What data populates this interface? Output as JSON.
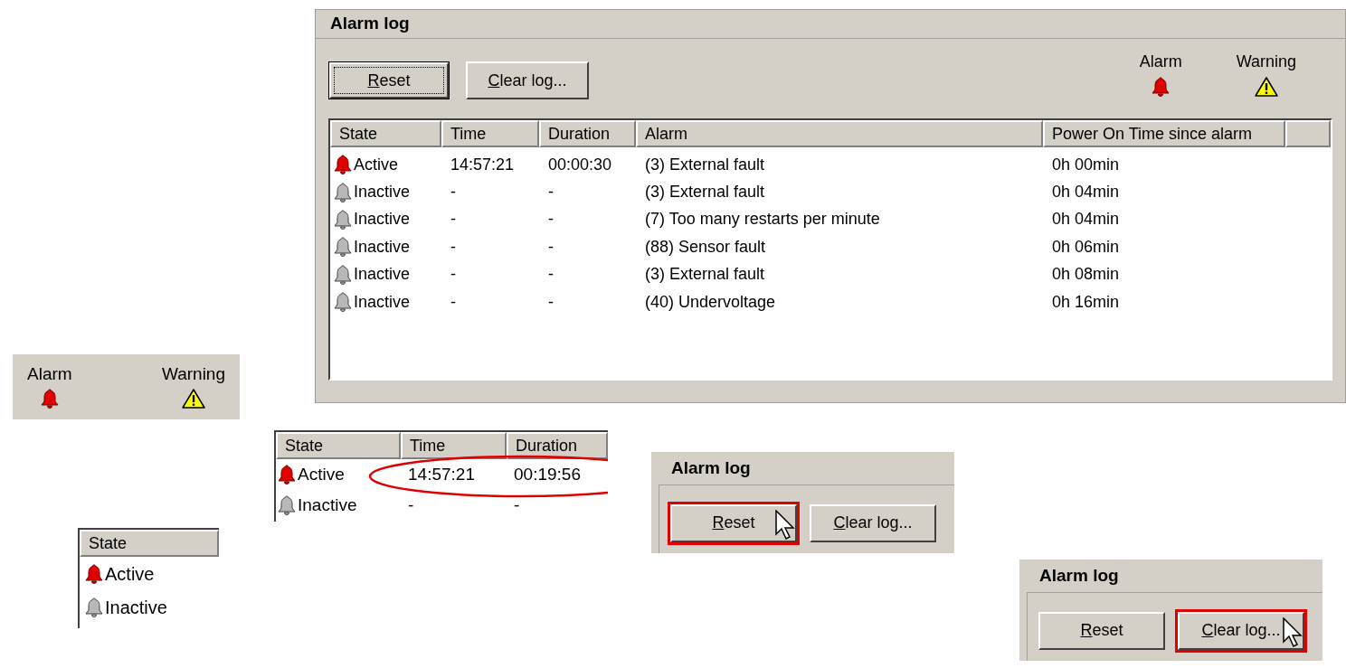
{
  "main_panel": {
    "title": "Alarm log",
    "buttons": [
      {
        "label": "Reset",
        "focused": true
      },
      {
        "label": "Clear log...",
        "focused": false
      }
    ],
    "legend": [
      {
        "label": "Alarm",
        "kind": "alarm"
      },
      {
        "label": "Warning",
        "kind": "warning"
      }
    ],
    "table": {
      "columns": [
        "State",
        "Time",
        "Duration",
        "Alarm",
        "Power On Time since alarm"
      ],
      "rows": [
        {
          "state": "Active",
          "active": true,
          "time": "14:57:21",
          "duration": "00:00:30",
          "alarm": "(3) External fault",
          "power_on_time": "0h 00min"
        },
        {
          "state": "Inactive",
          "active": false,
          "time": "-",
          "duration": "-",
          "alarm": "(3) External fault",
          "power_on_time": "0h 04min"
        },
        {
          "state": "Inactive",
          "active": false,
          "time": "-",
          "duration": "-",
          "alarm": "(7) Too many restarts per minute",
          "power_on_time": "0h 04min"
        },
        {
          "state": "Inactive",
          "active": false,
          "time": "-",
          "duration": "-",
          "alarm": "(88) Sensor fault",
          "power_on_time": "0h 06min"
        },
        {
          "state": "Inactive",
          "active": false,
          "time": "-",
          "duration": "-",
          "alarm": "(3) External fault",
          "power_on_time": "0h 08min"
        },
        {
          "state": "Inactive",
          "active": false,
          "time": "-",
          "duration": "-",
          "alarm": "(40) Undervoltage",
          "power_on_time": "0h 16min"
        }
      ]
    }
  },
  "legend_detail": {
    "items": [
      {
        "label": "Alarm",
        "kind": "alarm"
      },
      {
        "label": "Warning",
        "kind": "warning"
      }
    ]
  },
  "time_detail": {
    "columns": [
      "State",
      "Time",
      "Duration"
    ],
    "rows": [
      {
        "state": "Active",
        "active": true,
        "time": "14:57:21",
        "duration": "00:19:56"
      },
      {
        "state": "Inactive",
        "active": false,
        "time": "-",
        "duration": "-"
      }
    ]
  },
  "state_detail": {
    "column": "State",
    "rows": [
      {
        "state": "Active",
        "active": true
      },
      {
        "state": "Inactive",
        "active": false
      }
    ]
  },
  "reset_detail": {
    "title": "Alarm log",
    "buttons": [
      {
        "label": "Reset",
        "highlighted": true
      },
      {
        "label": "Clear log...",
        "highlighted": false
      }
    ]
  },
  "clear_detail": {
    "title": "Alarm log",
    "buttons": [
      {
        "label": "Reset",
        "highlighted": false
      },
      {
        "label": "Clear log...",
        "highlighted": true
      }
    ]
  }
}
